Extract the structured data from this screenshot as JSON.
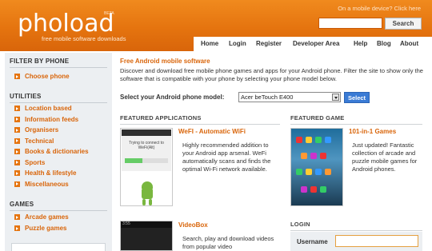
{
  "header": {
    "logo": "phoload",
    "beta": "BETA",
    "tagline": "free mobile software downloads",
    "mobile_link": "On a mobile device? Click here",
    "search_value": "",
    "search_button": "Search",
    "nav": [
      "Home",
      "Login",
      "Register",
      "Developer Area",
      "Help",
      "Blog",
      "About"
    ]
  },
  "sidebar": {
    "filter_title": "FILTER BY PHONE",
    "choose_phone": "Choose phone",
    "utilities_title": "UTILITIES",
    "utilities": [
      "Location based",
      "Information feeds",
      "Organisers",
      "Technical",
      "Books & dictionaries",
      "Sports",
      "Health & lifestyle",
      "Miscellaneous"
    ],
    "games_title": "GAMES",
    "games": [
      "Arcade games",
      "Puzzle games"
    ]
  },
  "main": {
    "title": "Free Android mobile software",
    "intro": "Discover and download free mobile phone games and apps for your Android phone. Filter the site to show only the software that is compatible with your phone by selecting your phone model below.",
    "select_label": "Select your Android phone model:",
    "select_value": "Acer beTouch E400",
    "select_button": "Select"
  },
  "featured_apps": {
    "heading": "FEATURED APPLICATIONS",
    "app1": {
      "title": "WeFI - Automatic WiFi",
      "desc": "Highly recommended addition to your Android app arsenal. WeFi automatically scans and finds the optimal Wi-Fi network available.",
      "screen_text": "Trying to connect to WeFi(Alt)"
    },
    "app2": {
      "title": "VideoBox",
      "desc": "Search, play and download videos from popular video",
      "status_text": "3:55"
    }
  },
  "featured_game": {
    "heading": "FEATURED GAME",
    "title": "101-in-1 Games",
    "desc": "Just updated! Fantastic collection of arcade and puzzle mobile games for Android phones."
  },
  "login": {
    "heading": "LOGIN",
    "username_label": "Username",
    "username_value": ""
  },
  "colors": {
    "brand_orange": "#e5740f",
    "link_orange": "#d9650a",
    "sidebar_bg": "#eceff2",
    "select_button_blue": "#3a7bd5"
  }
}
